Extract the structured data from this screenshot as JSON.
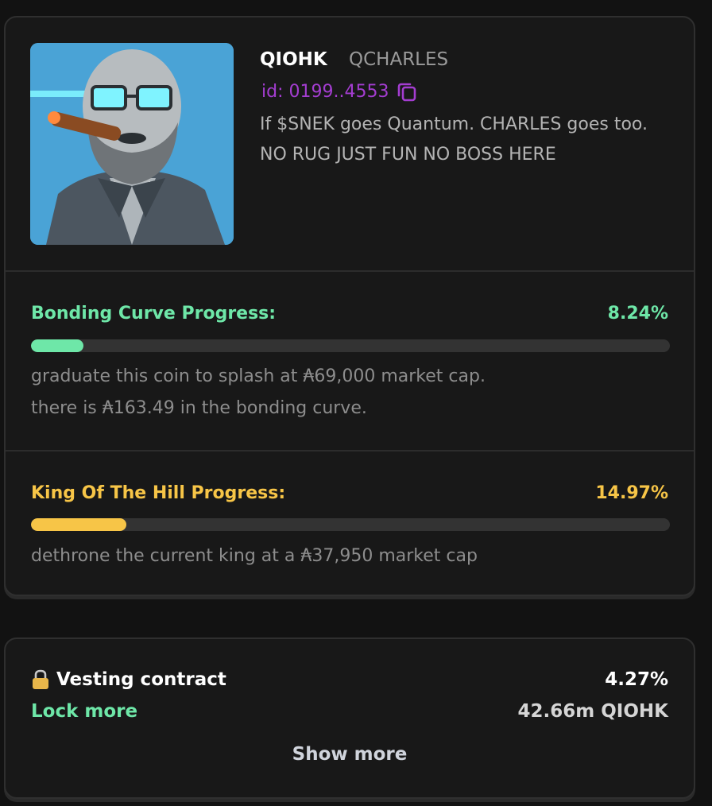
{
  "token": {
    "ticker": "QIOHK",
    "username": "QCHARLES",
    "id": "id: 0199..4553",
    "description": "If $SNEK goes Quantum. CHARLES goes too. NO RUG JUST FUN NO BOSS HERE",
    "avatar_icon": "cartoon-bearded-man-cigar-avatar",
    "copy_icon": "copy-icon"
  },
  "bonding": {
    "title": "Bonding Curve Progress:",
    "percent": "8.24%",
    "progress": 0.0824,
    "line1": "graduate this coin to splash at ₳69,000 market cap.",
    "line2": "there is ₳163.49 in the bonding curve.",
    "color": "#6ee7a8"
  },
  "koth": {
    "title": "King Of The Hill Progress:",
    "percent": "14.97%",
    "progress": 0.1497,
    "line1": "dethrone the current king at a ₳37,950 market cap",
    "color": "#f7c547"
  },
  "vesting": {
    "title": "Vesting contract",
    "percent": "4.27%",
    "lock_more": "Lock more",
    "amount": "42.66m QIOHK",
    "show_more": "Show more",
    "lock_icon": "lock-icon"
  }
}
